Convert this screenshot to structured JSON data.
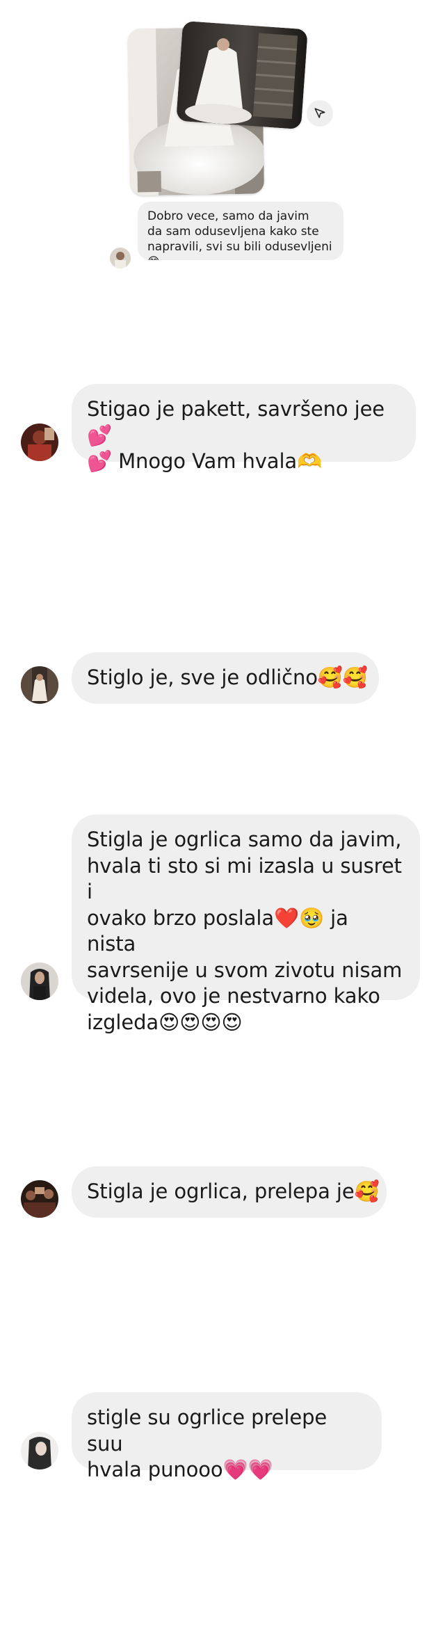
{
  "shared_post": {
    "caption": "Dobro vece, samo da javim\nda sam odusevljena kako ste\nnapravili, svi su bili odusevljeni😊"
  },
  "messages": [
    {
      "id": "m1",
      "text": "Stigao je pakett, savršeno jee💕\n💕 Mnogo Vam hvala🫶"
    },
    {
      "id": "m2",
      "text": "Stiglo je, sve je odlično🥰🥰"
    },
    {
      "id": "m3",
      "text": "Stigla je ogrlica samo da javim,\nhvala ti sto si mi izasla u susret i\novako brzo poslala❤️🥹 ja nista\nsavrsenije u svom zivotu nisam\nvidela, ovo je nestvarno kako\nizgleda😍😍😍😍"
    },
    {
      "id": "m4",
      "text": "Stigla je ogrlica, prelepa je🥰"
    },
    {
      "id": "m5",
      "text": "stigle su ogrlice prelepe suu\nhvala punooo💗💗"
    }
  ],
  "icons": {
    "share": "paper-plane-icon"
  }
}
